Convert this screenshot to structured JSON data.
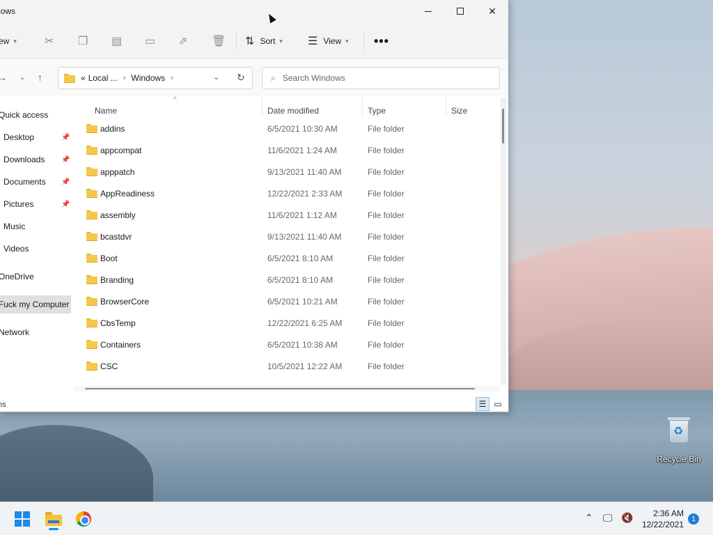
{
  "window": {
    "title": "lows",
    "minimize_icon": "minimize-icon",
    "maximize_icon": "maximize-icon",
    "close_icon": "close-icon"
  },
  "toolbar": {
    "new_label": "ew",
    "sort_label": "Sort",
    "view_label": "View",
    "more_label": "•••"
  },
  "address": {
    "prefix": "«",
    "crumb1": "Local ...",
    "crumb2": "Windows"
  },
  "search": {
    "placeholder": "Search Windows"
  },
  "sidebar": {
    "items": [
      {
        "label": "Quick access",
        "pinned": false
      },
      {
        "label": "Desktop",
        "pinned": true
      },
      {
        "label": "Downloads",
        "pinned": true
      },
      {
        "label": "Documents",
        "pinned": true
      },
      {
        "label": "Pictures",
        "pinned": true
      },
      {
        "label": "Music",
        "pinned": false
      },
      {
        "label": "Videos",
        "pinned": false
      },
      {
        "label": "OneDrive",
        "pinned": false
      },
      {
        "label": "Fuck my Computer",
        "pinned": false
      },
      {
        "label": "Network",
        "pinned": false
      }
    ]
  },
  "columns": {
    "name": "Name",
    "date": "Date modified",
    "type": "Type",
    "size": "Size"
  },
  "files": [
    {
      "name": "addins",
      "date": "6/5/2021 10:30 AM",
      "type": "File folder"
    },
    {
      "name": "appcompat",
      "date": "11/6/2021 1:24 AM",
      "type": "File folder"
    },
    {
      "name": "apppatch",
      "date": "9/13/2021 11:40 AM",
      "type": "File folder"
    },
    {
      "name": "AppReadiness",
      "date": "12/22/2021 2:33 AM",
      "type": "File folder"
    },
    {
      "name": "assembly",
      "date": "11/6/2021 1:12 AM",
      "type": "File folder"
    },
    {
      "name": "bcastdvr",
      "date": "9/13/2021 11:40 AM",
      "type": "File folder"
    },
    {
      "name": "Boot",
      "date": "6/5/2021 8:10 AM",
      "type": "File folder"
    },
    {
      "name": "Branding",
      "date": "6/5/2021 8:10 AM",
      "type": "File folder"
    },
    {
      "name": "BrowserCore",
      "date": "6/5/2021 10:21 AM",
      "type": "File folder"
    },
    {
      "name": "CbsTemp",
      "date": "12/22/2021 6:25 AM",
      "type": "File folder"
    },
    {
      "name": "Containers",
      "date": "6/5/2021 10:38 AM",
      "type": "File folder"
    },
    {
      "name": "CSC",
      "date": "10/5/2021 12:22 AM",
      "type": "File folder"
    }
  ],
  "status": {
    "text": "ns"
  },
  "desktop": {
    "recycle_bin": "Recycle Bin"
  },
  "taskbar": {
    "time": "2:36 AM",
    "date": "12/22/2021",
    "notifications": "1"
  }
}
